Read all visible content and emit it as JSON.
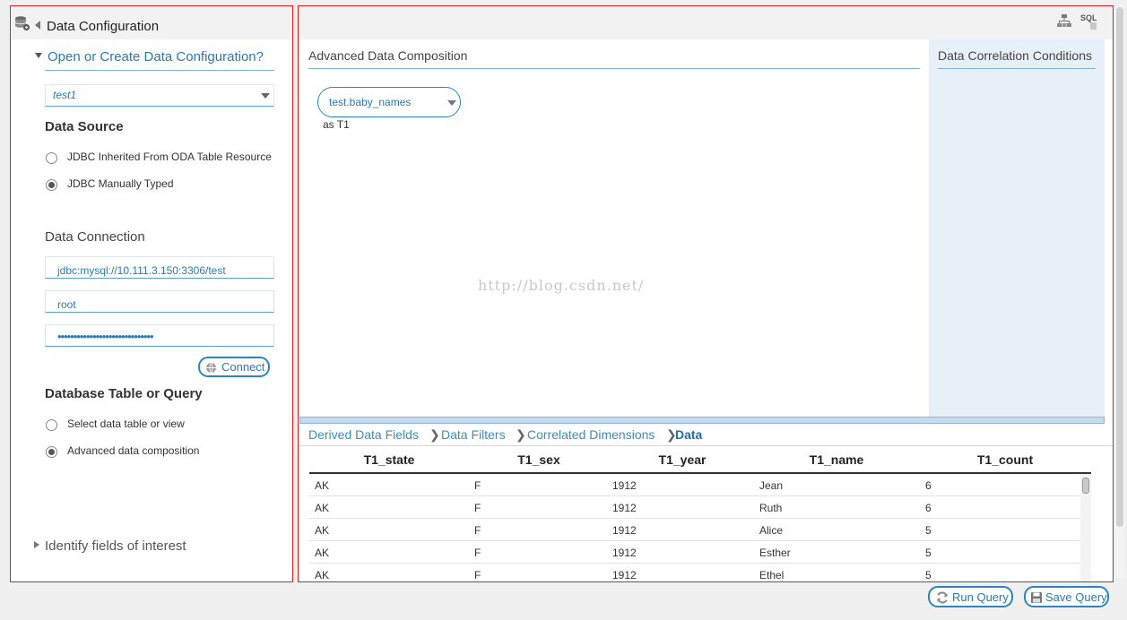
{
  "left_panel": {
    "title": "Data Configuration",
    "open_create_link": "Open or Create Data Configuration?",
    "config_select": {
      "value": "test1"
    },
    "data_source": {
      "heading": "Data Source",
      "options": [
        {
          "label": "JDBC Inherited From ODA Table Resource",
          "checked": false
        },
        {
          "label": "JDBC Manually Typed",
          "checked": true
        }
      ]
    },
    "data_connection": {
      "heading": "Data Connection",
      "url": "jdbc:mysql://10.111.3.150:3306/test",
      "user": "root",
      "password": "••••••••••••••••••••••••••••••",
      "connect_label": "Connect"
    },
    "table_or_query": {
      "heading": "Database Table or Query",
      "options": [
        {
          "label": "Select data table or view",
          "checked": false
        },
        {
          "label": "Advanced data composition",
          "checked": true
        }
      ]
    },
    "identify_fields": "Identify fields of interest"
  },
  "main_panel": {
    "toolbar": {
      "sql_label": "SQL"
    },
    "composition": {
      "title": "Advanced Data Composition",
      "table_chip": "test.baby_names",
      "alias": "as T1"
    },
    "correlation": {
      "title": "Data Correlation Conditions"
    },
    "watermark": "http://blog.csdn.net/",
    "breadcrumbs": [
      {
        "label": "Derived Data Fields",
        "active": false
      },
      {
        "label": "Data Filters",
        "active": false
      },
      {
        "label": "Correlated Dimensions",
        "active": false
      },
      {
        "label": "Data",
        "active": true
      }
    ],
    "table": {
      "columns": [
        "T1_state",
        "T1_sex",
        "T1_year",
        "T1_name",
        "T1_count"
      ],
      "rows": [
        [
          "AK",
          "F",
          "1912",
          "Jean",
          "6"
        ],
        [
          "AK",
          "F",
          "1912",
          "Ruth",
          "6"
        ],
        [
          "AK",
          "F",
          "1912",
          "Alice",
          "5"
        ],
        [
          "AK",
          "F",
          "1912",
          "Esther",
          "5"
        ],
        [
          "AK",
          "F",
          "1912",
          "Ethel",
          "5"
        ]
      ]
    }
  },
  "footer": {
    "run_query_label": "Run Query",
    "save_query_label": "Save Query"
  },
  "colors": {
    "accent": "#2a85c2",
    "panel_border": "#e02020",
    "correlation_bg": "#e7f0f8"
  }
}
